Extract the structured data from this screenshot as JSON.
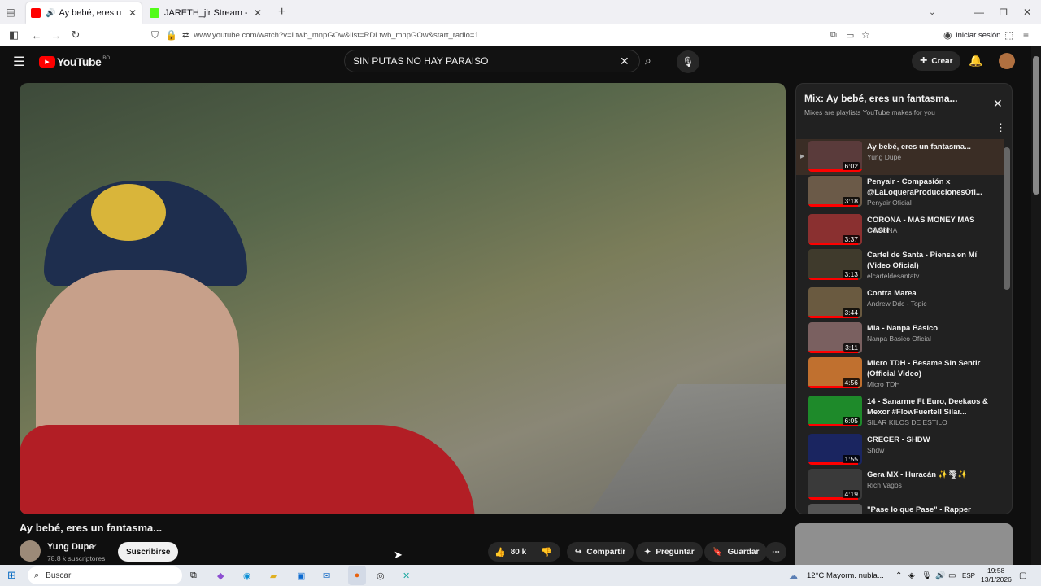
{
  "browser": {
    "tabs": [
      {
        "label": "Ay bebé, eres un fantasma",
        "active": true,
        "favicon_color": "#ff0000"
      },
      {
        "label": "JARETH_jlr Stream - Watch Live",
        "active": false,
        "favicon_color": "#53fc18"
      }
    ],
    "url": "www.youtube.com/watch?v=Ltwb_mnpGOw&list=RDLtwb_mnpGOw&start_radio=1",
    "signin_label": "Iniciar sesión"
  },
  "youtube": {
    "logo_text": "YouTube",
    "logo_country": "BO",
    "search_value": "SIN PUTAS NO HAY PARAISO",
    "create_label": "Crear"
  },
  "video": {
    "title": "Ay bebé, eres un fantasma...",
    "channel": "Yung Dupe",
    "subscribers": "78.8 k suscriptores",
    "subscribe_label": "Suscribirse",
    "likes": "80 k",
    "share_label": "Compartir",
    "ask_label": "Preguntar",
    "save_label": "Guardar"
  },
  "playlist": {
    "title": "Mix: Ay bebé, eres un fantasma...",
    "subtitle": "Mixes are playlists YouTube makes for you",
    "items": [
      {
        "title": "Ay bebé, eres un fantasma...",
        "channel": "Yung Dupe",
        "duration": "6:02",
        "thumb": "#5a3b3b",
        "playing": true
      },
      {
        "title": "Penyair - Compasión x @LaLoqueraProduccionesOfi...",
        "channel": "Penyair Oficial",
        "duration": "3:18",
        "thumb": "#6b5a48"
      },
      {
        "title": "CORONA - MAS MONEY MAS CASH",
        "channel": "CORONA",
        "duration": "3:37",
        "thumb": "#8a3030"
      },
      {
        "title": "Cartel de Santa - Piensa en Mí (Video Oficial)",
        "channel": "elcarteldesantatv",
        "duration": "3:13",
        "thumb": "#3f3a2c"
      },
      {
        "title": "Contra Marea",
        "channel": "Andrew Ddc - Topic",
        "duration": "3:44",
        "thumb": "#6a5a40"
      },
      {
        "title": "Mia - Nanpa Básico",
        "channel": "Nanpa Basico Oficial",
        "duration": "3:11",
        "thumb": "#7a6060"
      },
      {
        "title": "Micro TDH - Besame Sin Sentir (Official Video)",
        "channel": "Micro TDH",
        "duration": "4:56",
        "thumb": "#c0702f"
      },
      {
        "title": "14 - Sanarme Ft Euro, Deekaos & Mexor #FlowFuerteII Silar...",
        "channel": "SILAR KILOS DE ESTILO",
        "duration": "6:05",
        "thumb": "#1e8a2a"
      },
      {
        "title": "CRECER - SHDW",
        "channel": "Shdw",
        "duration": "1:55",
        "thumb": "#1a2560"
      },
      {
        "title": "Gera MX - Huracán ✨🌪✨",
        "channel": "Rich Vagos",
        "duration": "4:19",
        "thumb": "#3a3a3a"
      },
      {
        "title": "\"Pase lo que Pase\" - Rapper",
        "channel": "",
        "duration": "",
        "thumb": "#555555"
      }
    ]
  },
  "taskbar": {
    "search_placeholder": "Buscar",
    "weather": "12°C",
    "weather_desc": "Mayorm. nubla...",
    "lang": "ESP",
    "time": "19:58",
    "date": "13/1/2026"
  },
  "colors": {
    "accent_red": "#ff0000",
    "bg": "#0f0f0f"
  }
}
